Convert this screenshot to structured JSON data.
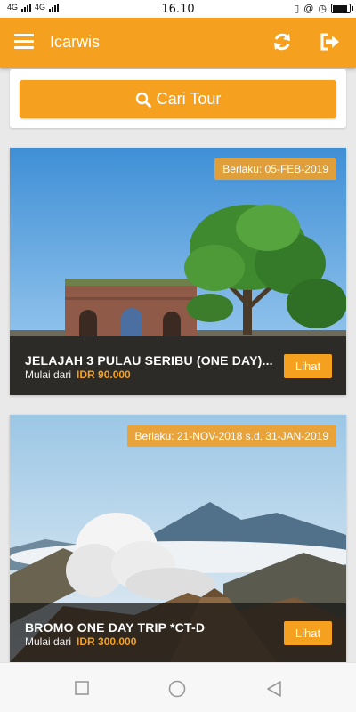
{
  "status_bar": {
    "network_left": "4G",
    "network_right": "4G",
    "time": "16.10",
    "icons": [
      "signal-icon",
      "vibrate-icon",
      "alarm-icon",
      "battery-icon"
    ]
  },
  "app_bar": {
    "title": "Icarwis",
    "icons": [
      "menu-icon",
      "refresh-icon",
      "logout-icon"
    ]
  },
  "search": {
    "label": "Cari Tour",
    "icon": "search-icon"
  },
  "tours": [
    {
      "validity": "Berlaku: 05-FEB-2019",
      "name": "JELAJAH 3 PULAU SERIBU (ONE DAY)...",
      "from_label": "Mulai dari",
      "price": "IDR 90.000",
      "button": "Lihat"
    },
    {
      "validity": "Berlaku: 21-NOV-2018 s.d. 31-JAN-2019",
      "name": "BROMO ONE DAY TRIP *CT-D",
      "from_label": "Mulai dari",
      "price": "IDR 300.000",
      "button": "Lihat"
    }
  ],
  "nav_bar": {
    "icons": [
      "recent-apps-icon",
      "home-icon",
      "back-icon"
    ]
  },
  "colors": {
    "accent": "#f5a11f",
    "caption_bg": "#141414"
  }
}
